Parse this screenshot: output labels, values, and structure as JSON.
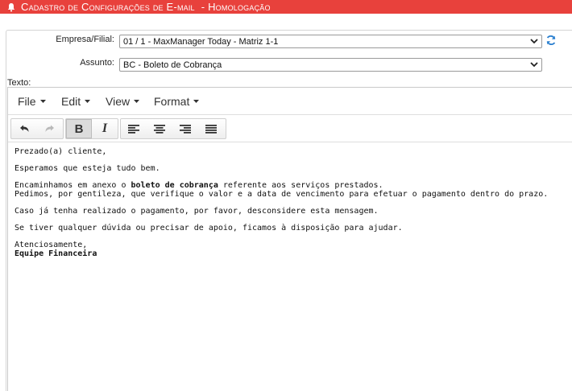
{
  "titlebar": {
    "title": "Cadastro de Configurações de E-mail",
    "environment": "- Homologação",
    "bg_color": "#e8413c"
  },
  "form": {
    "empresa": {
      "label": "Empresa/Filial:",
      "value": "01 / 1 - MaxManager Today - Matriz 1-1"
    },
    "assunto": {
      "label": "Assunto:",
      "value": "BC - Boleto de Cobrança"
    },
    "refresh_icon": "refresh-icon",
    "texto_label": "Texto:"
  },
  "editor": {
    "menu": {
      "file": "File",
      "edit": "Edit",
      "view": "View",
      "format": "Format"
    },
    "toolbar": [
      "undo-icon",
      "redo-icon",
      "bold-icon",
      "italic-icon",
      "align-left-icon",
      "align-center-icon",
      "align-right-icon",
      "align-justify-icon"
    ],
    "content": {
      "greeting": "Prezado(a) cliente,",
      "line1": "Esperamos que esteja tudo bem.",
      "line2_pre": "Encaminhamos em anexo o ",
      "line2_bold": "boleto de cobrança",
      "line2_post": " referente aos serviços prestados.",
      "line3": "Pedimos, por gentileza, que verifique o valor e a data de vencimento para efetuar o pagamento dentro do prazo.",
      "line4": "Caso já tenha realizado o pagamento, por favor, desconsidere esta mensagem.",
      "line5": "Se tiver qualquer dúvida ou precisar de apoio, ficamos à disposição para ajudar.",
      "closing": "Atenciosamente,",
      "signature": "Equipe Financeira"
    }
  }
}
